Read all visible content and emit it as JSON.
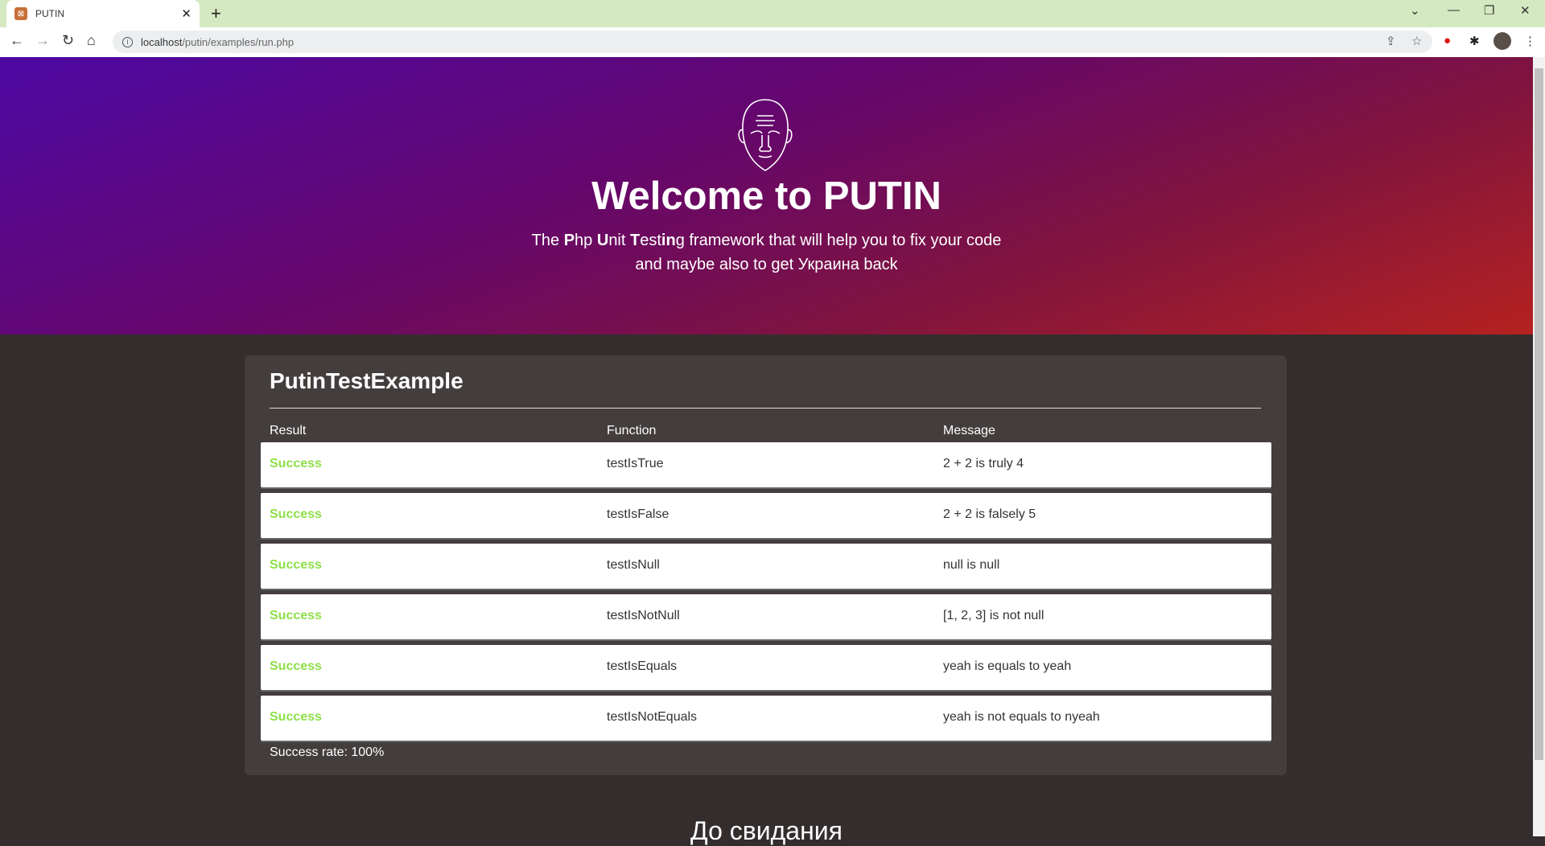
{
  "browser": {
    "tab_title": "PUTIN",
    "url_host": "localhost",
    "url_path": "/putin/examples/run.php"
  },
  "hero": {
    "title": "Welcome to PUTIN",
    "subtitle_parts": [
      "The ",
      "P",
      "hp ",
      "U",
      "nit ",
      "T",
      "est",
      "in",
      "g framework that will help you to fix your code"
    ],
    "subtitle_line2": "and maybe also to get Украина back"
  },
  "suite": {
    "name": "PutinTestExample",
    "headers": [
      "Result",
      "Function",
      "Message"
    ],
    "rows": [
      {
        "result": "Success",
        "function": "testIsTrue",
        "message": "2 + 2 is truly 4"
      },
      {
        "result": "Success",
        "function": "testIsFalse",
        "message": "2 + 2 is falsely 5"
      },
      {
        "result": "Success",
        "function": "testIsNull",
        "message": "null is null"
      },
      {
        "result": "Success",
        "function": "testIsNotNull",
        "message": "[1, 2, 3] is not null"
      },
      {
        "result": "Success",
        "function": "testIsEquals",
        "message": "yeah is equals to yeah"
      },
      {
        "result": "Success",
        "function": "testIsNotEquals",
        "message": "yeah is not equals to nyeah"
      }
    ],
    "success_rate": "Success rate: 100%"
  },
  "footer": {
    "text": "До свидания"
  },
  "colors": {
    "success": "#8ee04a",
    "card": "#433e3d",
    "bg": "#332e2d"
  }
}
